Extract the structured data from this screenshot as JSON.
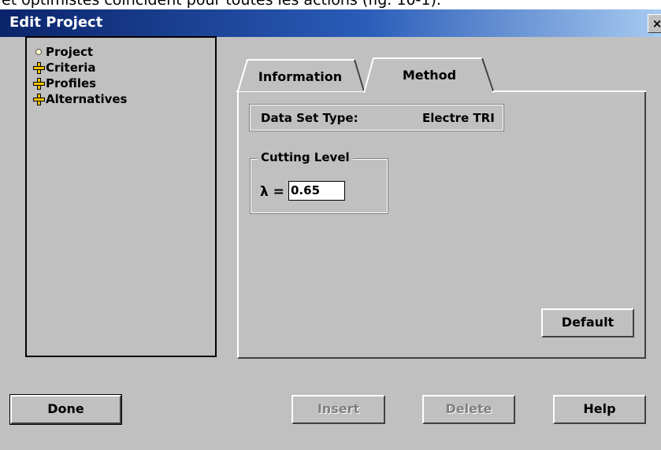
{
  "doc_snippet": "et optimistes coïncident pour toutes les actions (fig. 10-1).",
  "window": {
    "title": "Edit Project",
    "close_label": "×"
  },
  "tree": {
    "items": [
      {
        "label": "Project",
        "icon": "bullet-icon"
      },
      {
        "label": "Criteria",
        "icon": "expand-plus-icon"
      },
      {
        "label": "Profiles",
        "icon": "expand-plus-icon"
      },
      {
        "label": "Alternatives",
        "icon": "expand-plus-icon"
      }
    ]
  },
  "tabs": [
    {
      "label": "Information",
      "selected": false
    },
    {
      "label": "Method",
      "selected": true
    }
  ],
  "method": {
    "dataset_label": "Data Set Type:",
    "dataset_value": "Electre TRI",
    "cutting_level_label": "Cutting Level",
    "lambda_label": "λ =",
    "lambda_value": "0.65",
    "default_button": "Default"
  },
  "buttons": {
    "done": "Done",
    "insert": "Insert",
    "delete": "Delete",
    "help": "Help"
  },
  "colors": {
    "titlebar_start": "#0a246a",
    "titlebar_end": "#a6caf0",
    "face": "#c0c0c0",
    "plus_icon": "#f0c000"
  }
}
